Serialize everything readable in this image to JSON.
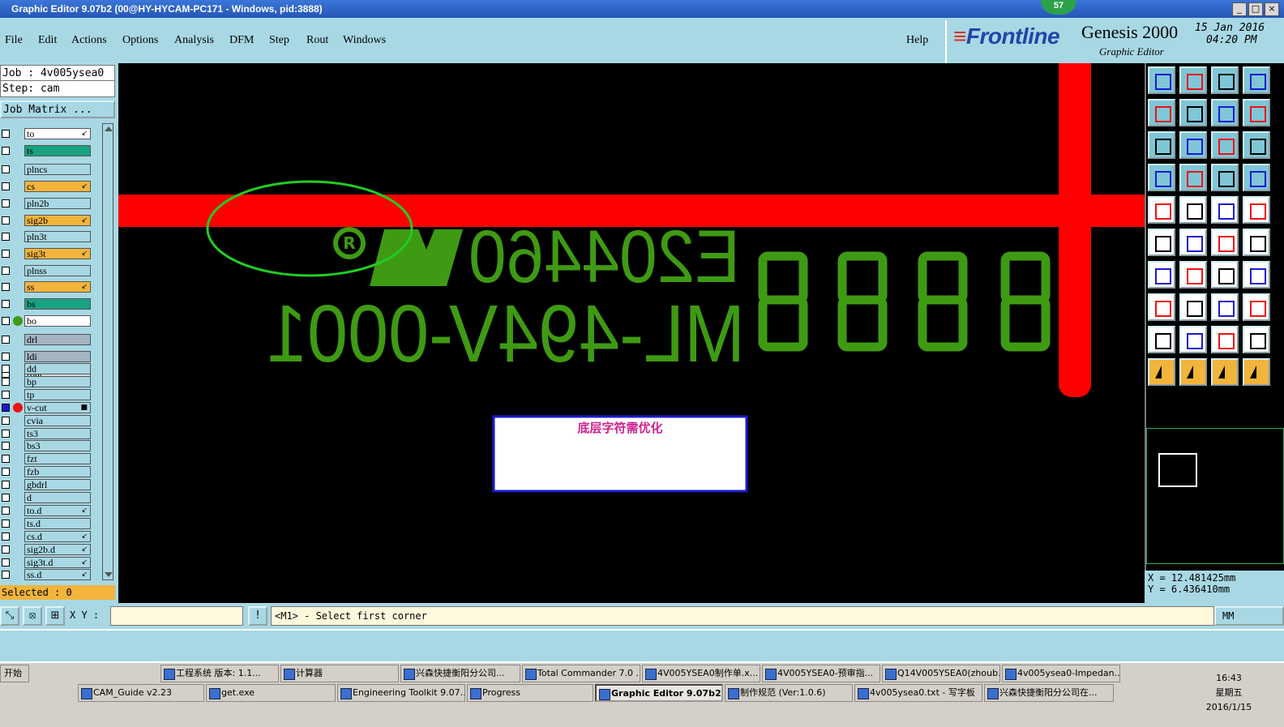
{
  "window": {
    "title": "Graphic Editor 9.07b2 (00@HY-HYCAM-PC171 - Windows, pid:3888)",
    "badge": "57"
  },
  "menu": {
    "items": [
      "File",
      "Edit",
      "Actions",
      "Options",
      "Analysis",
      "DFM",
      "Step",
      "Rout",
      "Windows"
    ],
    "help": "Help"
  },
  "branding": {
    "logo": "Frontline",
    "product": "Genesis 2000",
    "subtitle": "Graphic Editor",
    "date": "15 Jan 2016",
    "time": "04:20 PM"
  },
  "job": {
    "job_line": "Job : 4v005ysea0",
    "step_line": "Step: cam",
    "matrix_button": "Job Matrix ...",
    "selected_line": "Selected : 0"
  },
  "layers": [
    {
      "name": "to",
      "state": "white",
      "mark": "↙"
    },
    {
      "name": "ts",
      "state": "green",
      "mark": ""
    },
    {
      "name": "plncs",
      "state": "none",
      "mark": ""
    },
    {
      "name": "cs",
      "state": "yellow",
      "mark": "↙"
    },
    {
      "name": "pln2b",
      "state": "none",
      "mark": ""
    },
    {
      "name": "sig2b",
      "state": "yellow",
      "mark": "↙"
    },
    {
      "name": "pln3t",
      "state": "none",
      "mark": ""
    },
    {
      "name": "sig3t",
      "state": "yellow",
      "mark": "↙"
    },
    {
      "name": "plnss",
      "state": "none",
      "mark": ""
    },
    {
      "name": "ss",
      "state": "yellow",
      "mark": "↙"
    },
    {
      "name": "bs",
      "state": "green",
      "mark": ""
    },
    {
      "name": "bo",
      "state": "white",
      "mark": ""
    },
    {
      "name": "drl",
      "state": "gray",
      "mark": ""
    },
    {
      "name": "ldi",
      "state": "gray",
      "mark": ""
    },
    {
      "name": "rout",
      "state": "lightgray",
      "mark": ""
    },
    {
      "name": "dd",
      "state": "none",
      "mark": ""
    },
    {
      "name": "bp",
      "state": "none",
      "mark": ""
    },
    {
      "name": "tp",
      "state": "none",
      "mark": ""
    },
    {
      "name": "v-cut",
      "state": "none",
      "mark": "■"
    },
    {
      "name": "cvia",
      "state": "none",
      "mark": ""
    },
    {
      "name": "ts3",
      "state": "none",
      "mark": ""
    },
    {
      "name": "bs3",
      "state": "none",
      "mark": ""
    },
    {
      "name": "fzt",
      "state": "none",
      "mark": ""
    },
    {
      "name": "fzb",
      "state": "none",
      "mark": ""
    },
    {
      "name": "gbdrl",
      "state": "none",
      "mark": ""
    },
    {
      "name": "d",
      "state": "none",
      "mark": ""
    },
    {
      "name": "to.d",
      "state": "none",
      "mark": "↙"
    },
    {
      "name": "ts.d",
      "state": "none",
      "mark": ""
    },
    {
      "name": "cs.d",
      "state": "none",
      "mark": "↙"
    },
    {
      "name": "sig2b.d",
      "state": "none",
      "mark": "↙"
    },
    {
      "name": "sig3t.d",
      "state": "none",
      "mark": "↙"
    },
    {
      "name": "ss.d",
      "state": "none",
      "mark": "↙"
    }
  ],
  "canvas": {
    "annotation": "底层字符需优化",
    "line1_text": "E204460",
    "line2_text": "ML-494V-0001",
    "registered_mark": "R",
    "digits": "8888",
    "colors": {
      "trace": "#ff0000",
      "silk": "#3f9a13",
      "highlight": "#22cc22"
    }
  },
  "coords": {
    "x": "X = 12.481425mm",
    "y": "Y = 6.436410mm"
  },
  "command": {
    "xy_label": "X Y :",
    "status": "<M1> - Select first corner",
    "units": "MM"
  },
  "taskbar": {
    "start": "开始",
    "row1": [
      "工程系统  版本: 1.1...",
      "计算器",
      "兴森快捷衡阳分公司...",
      "Total Commander 7.0 ...",
      "4V005YSEA0制作单.x...",
      "4V005YSEA0-预审指...",
      "Q14V005YSEA0(zhoub...",
      "4v005ysea0-Impedan..."
    ],
    "row2": [
      "CAM_Guide v2.23",
      "get.exe",
      "Engineering Toolkit 9.07...",
      "Progress",
      "Graphic Editor 9.07b2 ...",
      "制作规范 (Ver:1.0.6)",
      "4v005ysea0.txt - 写字板",
      "兴森快捷衡阳分公司在..."
    ],
    "clock_time": "16:43",
    "clock_day": "星期五",
    "clock_date": "2016/1/15"
  }
}
